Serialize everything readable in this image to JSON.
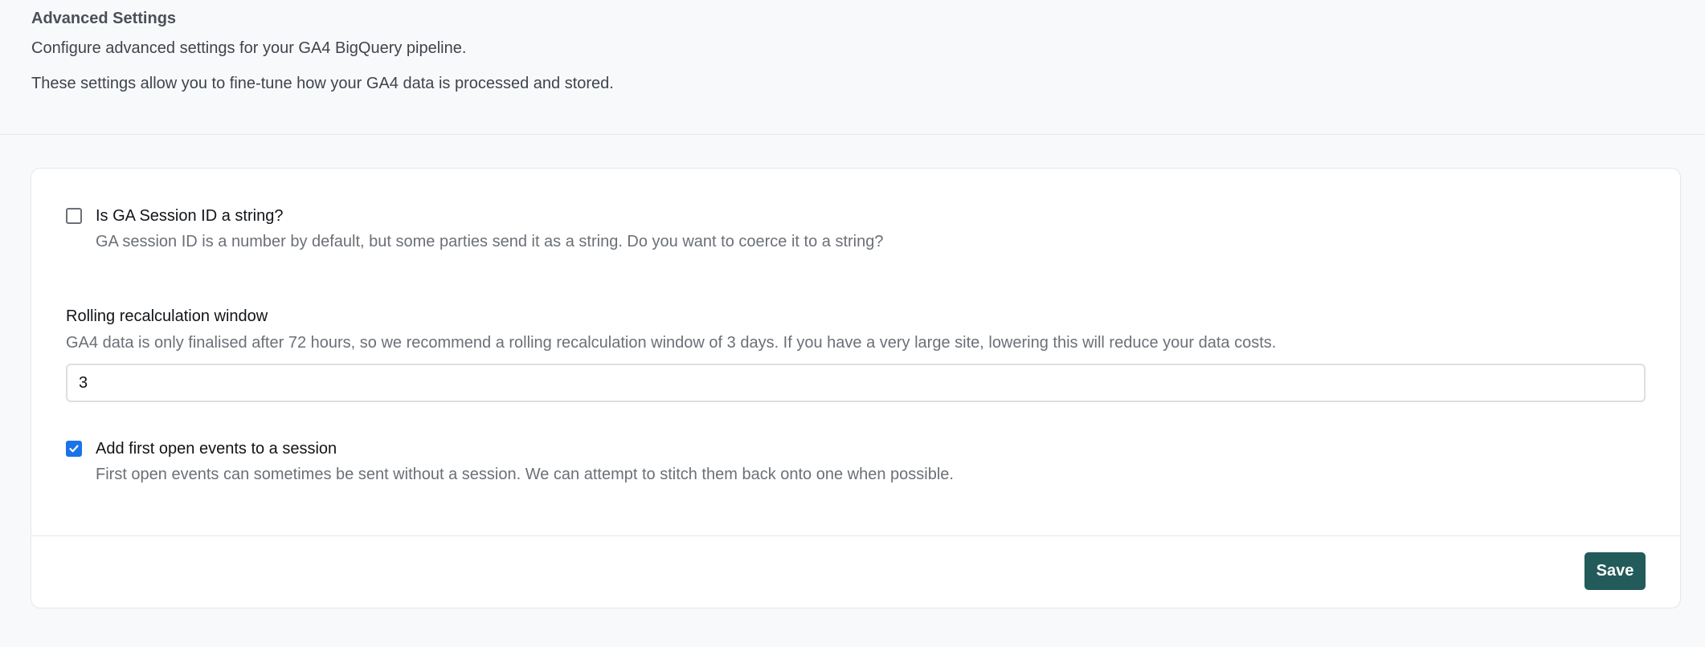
{
  "header": {
    "title": "Advanced Settings",
    "description": "Configure advanced settings for your GA4 BigQuery pipeline.",
    "description2": "These settings allow you to fine-tune how your GA4 data is processed and stored."
  },
  "settings": {
    "session_id_string": {
      "label": "Is GA Session ID a string?",
      "help": "GA session ID is a number by default, but some parties send it as a string. Do you want to coerce it to a string?",
      "checked": false
    },
    "rolling_window": {
      "label": "Rolling recalculation window",
      "help": "GA4 data is only finalised after 72 hours, so we recommend a rolling recalculation window of 3 days. If you have a very large site, lowering this will reduce your data costs.",
      "value": "3"
    },
    "first_open_events": {
      "label": "Add first open events to a session",
      "help": "First open events can sometimes be sent without a session. We can attempt to stitch them back onto one when possible.",
      "checked": true
    }
  },
  "footer": {
    "save_label": "Save"
  },
  "colors": {
    "accent": "#1a73e8",
    "save_button": "#235b5b"
  }
}
